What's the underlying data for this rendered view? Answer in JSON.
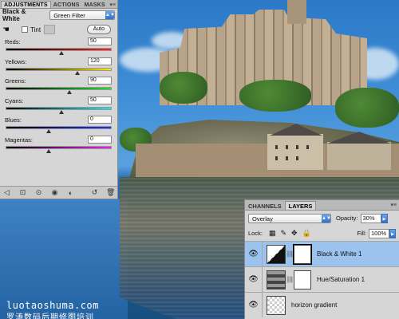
{
  "adjustments": {
    "tabs": [
      {
        "label": "ADJUSTMENTS"
      },
      {
        "label": "ACTIONS"
      },
      {
        "label": "MASKS"
      }
    ],
    "panel_title": "Black & White",
    "preset": "Green Filter",
    "tint_label": "Tint",
    "tint_checked": false,
    "auto_label": "Auto",
    "sliders": [
      {
        "label": "Reds:",
        "value": "50",
        "fraction": 0.52
      },
      {
        "label": "Yellows:",
        "value": "120",
        "fraction": 0.67
      },
      {
        "label": "Greens:",
        "value": "90",
        "fraction": 0.6
      },
      {
        "label": "Cyans:",
        "value": "50",
        "fraction": 0.52
      },
      {
        "label": "Blues:",
        "value": "0",
        "fraction": 0.4
      },
      {
        "label": "Magentas:",
        "value": "0",
        "fraction": 0.4
      }
    ]
  },
  "layers_panel": {
    "tabs": [
      {
        "label": "CHANNELS"
      },
      {
        "label": "LAYERS"
      }
    ],
    "blend_mode": "Overlay",
    "opacity_label": "Opacity:",
    "opacity": "30%",
    "lock_label": "Lock:",
    "fill_label": "Fill:",
    "fill": "100%",
    "layers": [
      {
        "name": "Black & White 1",
        "selected": true
      },
      {
        "name": "Hue/Saturation 1",
        "selected": false
      },
      {
        "name": "horizon gradient",
        "selected": false
      }
    ]
  },
  "watermark": {
    "line1": "luotaoshuma.com",
    "line2": "罗涛数码后期修图培训"
  }
}
